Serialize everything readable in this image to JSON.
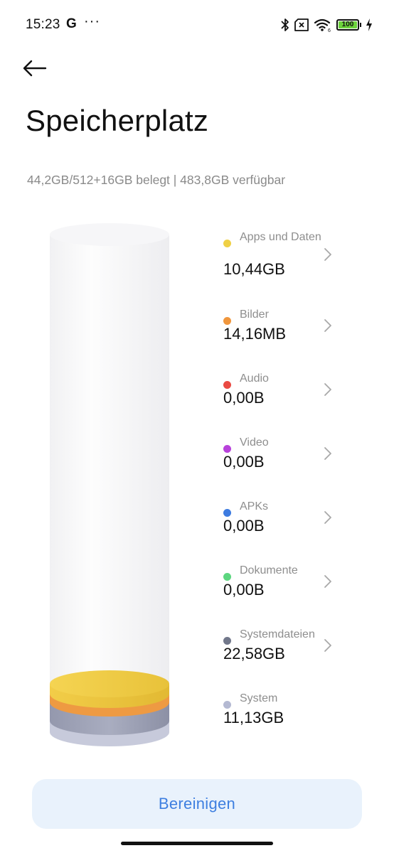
{
  "status_bar": {
    "time": "15:23",
    "g_label": "G",
    "more_label": "···",
    "battery_level": "100",
    "battery_color": "#6cd33c",
    "wifi_sub": "6"
  },
  "header": {
    "back_icon": "back-arrow-icon",
    "title": "Speicherplatz"
  },
  "summary": "44,2GB/512+16GB belegt | 483,8GB verfügbar",
  "categories": [
    {
      "name": "Apps und Daten",
      "value": "10,44GB",
      "color": "#efd045",
      "chevron": true
    },
    {
      "name": "Bilder",
      "value": "14,16MB",
      "color": "#f0963c",
      "chevron": true
    },
    {
      "name": "Audio",
      "value": "0,00B",
      "color": "#ea4a43",
      "chevron": true
    },
    {
      "name": "Video",
      "value": "0,00B",
      "color": "#b842db",
      "chevron": true
    },
    {
      "name": "APKs",
      "value": "0,00B",
      "color": "#3d7be0",
      "chevron": true
    },
    {
      "name": "Dokumente",
      "value": "0,00B",
      "color": "#5cd67f",
      "chevron": true
    },
    {
      "name": "Systemdateien",
      "value": "22,58GB",
      "color": "#71778a",
      "chevron": true
    },
    {
      "name": "System",
      "value": "11,13GB",
      "color": "#b4b9d2",
      "chevron": false
    }
  ],
  "clean_button": {
    "label": "Bereinigen",
    "text_color": "#3e7fe0",
    "background": "#e9f2fc"
  }
}
